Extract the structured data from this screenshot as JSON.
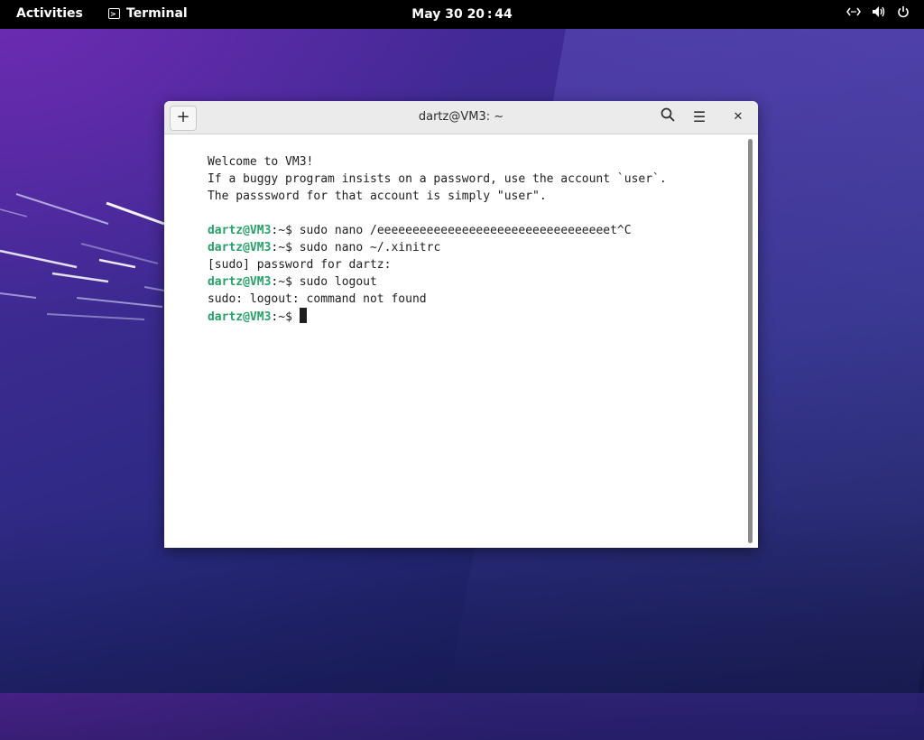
{
  "topbar": {
    "activities": "Activities",
    "app_name": "Terminal",
    "clock": "May 30  20 : 44"
  },
  "window": {
    "title": "dartz@VM3: ~"
  },
  "terminal": {
    "lines": [
      {
        "prompt": "",
        "text": "Welcome to VM3!"
      },
      {
        "prompt": "",
        "text": "If a buggy program insists on a password, use the account `user`."
      },
      {
        "prompt": "",
        "text": "The passsword for that account is simply \"user\"."
      },
      {
        "prompt": "",
        "text": ""
      },
      {
        "prompt": "dartz@VM3",
        "path": ":~$ ",
        "text": "sudo nano /eeeeeeeeeeeeeeeeeeeeeeeeeeeeeeeeet^C"
      },
      {
        "prompt": "dartz@VM3",
        "path": ":~$ ",
        "text": "sudo nano ~/.xinitrc"
      },
      {
        "prompt": "",
        "text": "[sudo] password for dartz:"
      },
      {
        "prompt": "dartz@VM3",
        "path": ":~$ ",
        "text": "sudo logout"
      },
      {
        "prompt": "",
        "text": "sudo: logout: command not found"
      },
      {
        "prompt": "dartz@VM3",
        "path": ":~$ ",
        "text": ""
      }
    ]
  },
  "icons": {
    "new_tab": "+",
    "menu": "☰",
    "close": "✕"
  },
  "colors": {
    "prompt_user": "#26a269",
    "topbar": "#000000"
  }
}
